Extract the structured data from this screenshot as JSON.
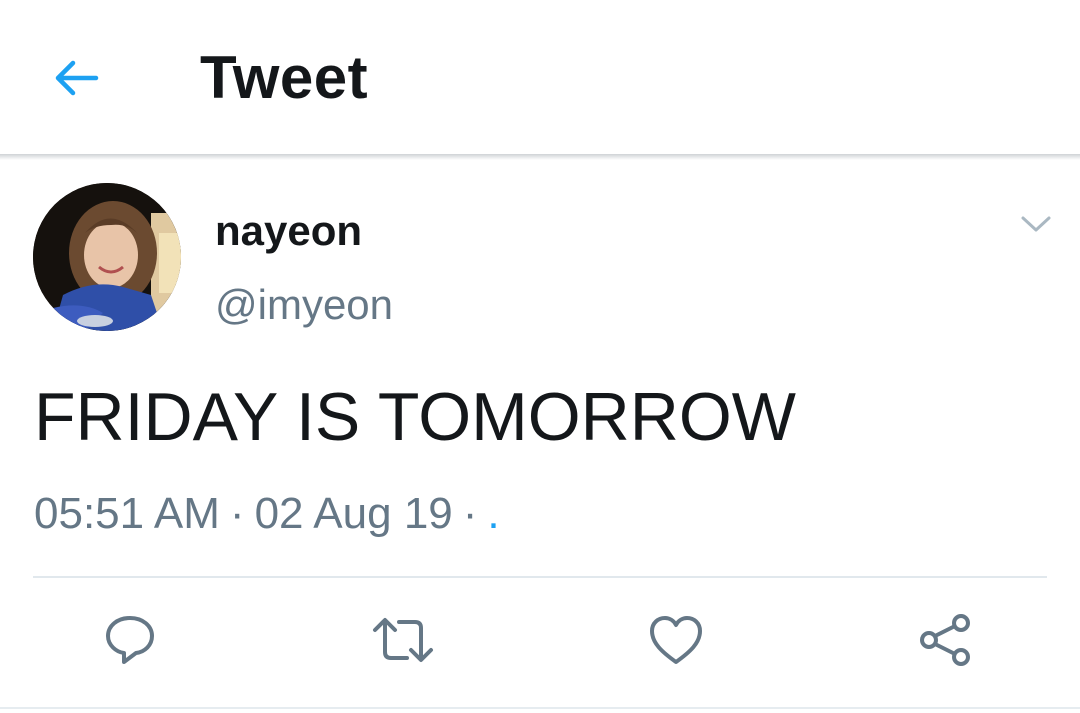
{
  "header": {
    "title": "Tweet",
    "back_icon": "arrow-left-icon"
  },
  "colors": {
    "accent": "#1da1f2",
    "text_primary": "#14171a",
    "text_secondary": "#657786",
    "divider": "#e1e8ed"
  },
  "tweet": {
    "author": {
      "display_name": "nayeon",
      "handle": "@imyeon"
    },
    "text": "FRIDAY IS TOMORROW",
    "time": "05:51 AM",
    "date": "02 Aug 19",
    "separator": "·",
    "via": "."
  },
  "actions": [
    {
      "name": "reply",
      "icon": "reply-icon"
    },
    {
      "name": "retweet",
      "icon": "retweet-icon"
    },
    {
      "name": "like",
      "icon": "heart-icon"
    },
    {
      "name": "share",
      "icon": "share-icon"
    }
  ]
}
